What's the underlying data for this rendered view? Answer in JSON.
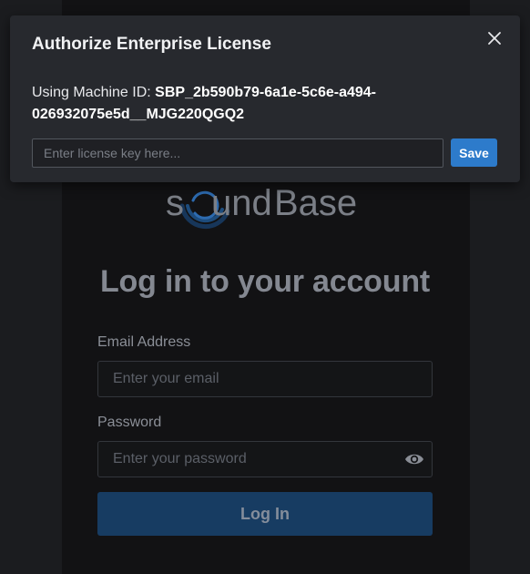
{
  "modal": {
    "title": "Authorize Enterprise License",
    "machine_prefix": "Using Machine ID: ",
    "machine_id": "SBP_2b590b79-6a1e-5c6e-a494-026932075e5d__MJG220QGQ2",
    "license_placeholder": "Enter license key here...",
    "save_label": "Save",
    "close_icon": "close-icon"
  },
  "login": {
    "brand": {
      "part1": "s",
      "part2": "und",
      "part3": "Base"
    },
    "title": "Log in to your account",
    "email_label": "Email Address",
    "email_placeholder": "Enter your email",
    "password_label": "Password",
    "password_placeholder": "Enter your password",
    "password_toggle_icon": "eye-icon",
    "login_label": "Log In"
  },
  "colors": {
    "accent": "#2d7bcb",
    "login_button": "#173c62",
    "modal_bg": "#27292e",
    "page_bg": "#1b1c1f"
  }
}
